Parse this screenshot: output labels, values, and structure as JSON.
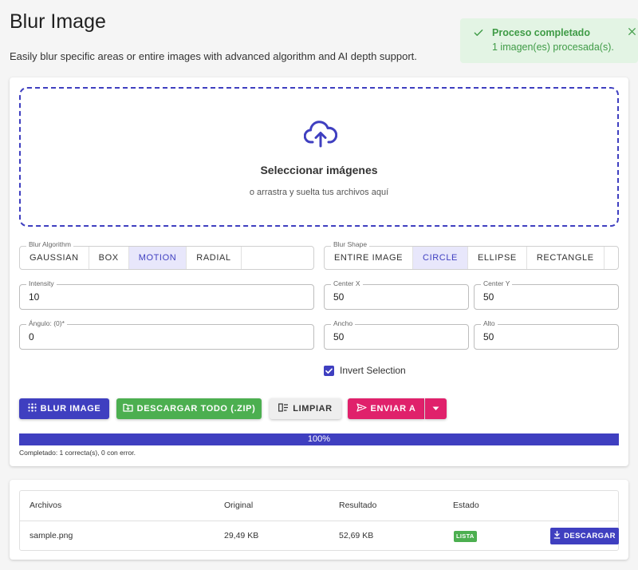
{
  "page": {
    "title": "Blur Image",
    "subtitle": "Easily blur specific areas or entire images with advanced algorithm and AI depth support."
  },
  "toast": {
    "title": "Proceso completado",
    "message": "1 imagen(es) procesada(s)."
  },
  "dropzone": {
    "title": "Seleccionar imágenes",
    "subtitle": "o arrastra y suelta tus archivos aquí"
  },
  "algorithm": {
    "label": "Blur Algorithm",
    "options": [
      "GAUSSIAN",
      "BOX",
      "MOTION",
      "RADIAL"
    ],
    "selected": "MOTION"
  },
  "shape": {
    "label": "Blur Shape",
    "options": [
      "ENTIRE IMAGE",
      "CIRCLE",
      "ELLIPSE",
      "RECTANGLE"
    ],
    "selected": "CIRCLE"
  },
  "fields": {
    "intensity": {
      "label": "Intensity",
      "value": "10"
    },
    "center_x": {
      "label": "Center X",
      "value": "50"
    },
    "center_y": {
      "label": "Center Y",
      "value": "50"
    },
    "angle": {
      "label": "Ángulo: (0)*",
      "value": "0"
    },
    "width": {
      "label": "Ancho",
      "value": "50"
    },
    "height": {
      "label": "Alto",
      "value": "50"
    }
  },
  "invert": {
    "label": "Invert Selection",
    "checked": true
  },
  "actions": {
    "blur": "BLUR IMAGE",
    "zip": "DESCARGAR TODO (.ZIP)",
    "clear": "LIMPIAR",
    "send": "ENVIAR A"
  },
  "progress": {
    "percent": 100,
    "label": "100%",
    "caption": "Completado: 1 correcta(s), 0 con error."
  },
  "table": {
    "headers": [
      "Archivos",
      "Original",
      "Resultado",
      "Estado"
    ],
    "rows": [
      {
        "file": "sample.png",
        "original": "29,49 KB",
        "result": "52,69 KB",
        "status": "LISTA",
        "action": "DESCARGAR"
      }
    ]
  },
  "colors": {
    "primary": "#3f3fc0",
    "success": "#4caf50",
    "accent": "#e0216b",
    "toast_bg": "#e3f4e4",
    "toast_text": "#3f9b46"
  }
}
